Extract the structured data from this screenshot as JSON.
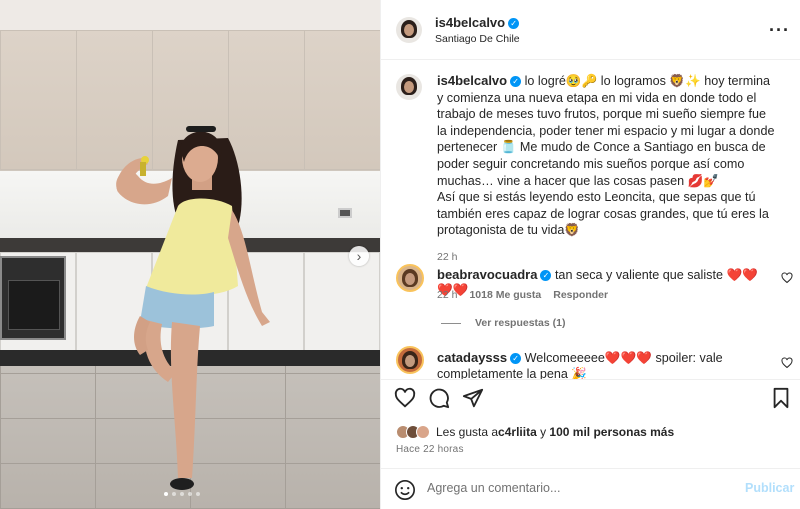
{
  "header": {
    "username": "is4belcalvo",
    "location": "Santiago De Chile"
  },
  "caption": {
    "username": "is4belcalvo",
    "text_part1": "lo logré🥹🔑 lo logramos 🦁✨ hoy termina y comienza una nueva etapa en mi vida en donde todo el trabajo de meses tuvo frutos, porque mi sueño siempre fue la independencia, poder tener mi espacio y mi lugar a donde pertenecer 🫙 Me mudo de Conce a Santiago en busca de poder seguir concretando mis sueños porque así como muchas… vine a hacer que las cosas pasen 💋💅",
    "text_part2": "Así que si estás leyendo esto Leoncita, que sepas que tú también eres capaz de lograr cosas grandes, que tú eres la protagonista de tu vida🦁",
    "time": "22 h"
  },
  "comments": [
    {
      "username": "beabravocuadra",
      "text": "tan seca y valiente que saliste ❤️❤️❤️❤️",
      "time": "22 h",
      "likes": "1018 Me gusta",
      "reply": "Responder",
      "view_replies": "Ver respuestas (1)"
    },
    {
      "username": "catadaysss",
      "text": "Welcomeeeee❤️❤️❤️ spoiler: vale completamente la pena 🎉"
    }
  ],
  "likes": {
    "prefix": "Les gusta a ",
    "user": "c4rliita",
    "connector": " y ",
    "others": "100 mil personas más"
  },
  "posted_ago": "Hace 22 horas",
  "comment_box": {
    "placeholder": "Agrega un comentario...",
    "publish_label": "Publicar"
  },
  "carousel": {
    "slide_count": 5,
    "active_index": 0
  },
  "icons": {
    "more": "more-options-icon",
    "like": "heart-icon",
    "comment": "comment-icon",
    "share": "share-icon",
    "save": "bookmark-icon",
    "emoji": "emoji-icon",
    "next": "chevron-right-icon"
  },
  "colors": {
    "verified": "#0095f6",
    "heart_red": "#ed4956",
    "publish": "#b2dffc"
  }
}
